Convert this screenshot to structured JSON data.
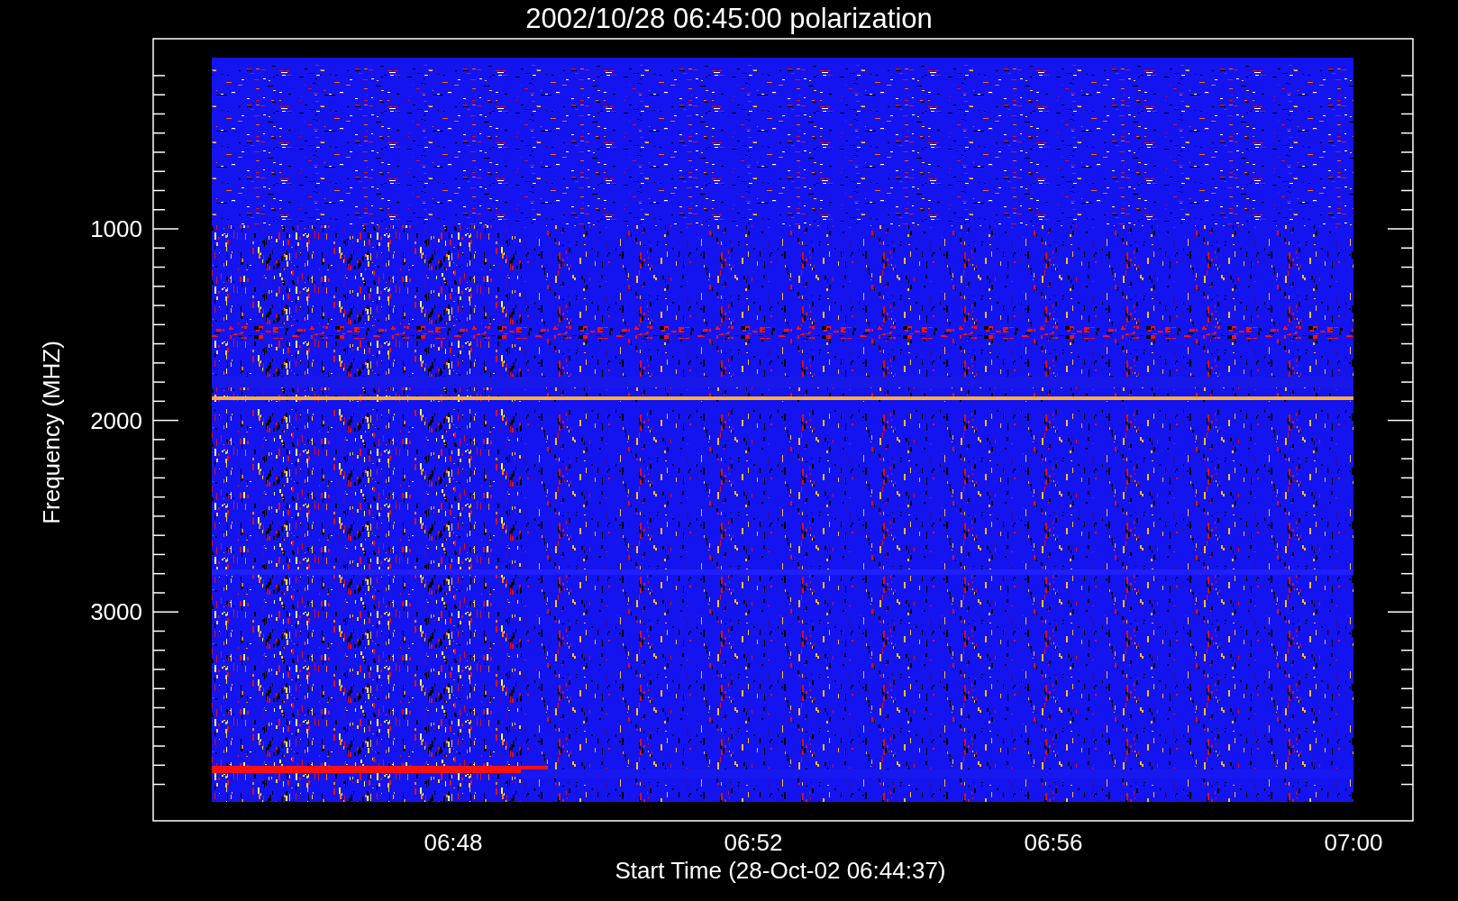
{
  "title": "2002/10/28 06:45:00 polarization",
  "y_axis": {
    "label": "Frequency (MHZ)",
    "ticks": [
      "1000",
      "2000",
      "3000"
    ]
  },
  "x_axis": {
    "label": "Start Time (28-Oct-02 06:44:37)",
    "ticks": [
      "06:48",
      "06:52",
      "06:56",
      "07:00"
    ]
  }
}
